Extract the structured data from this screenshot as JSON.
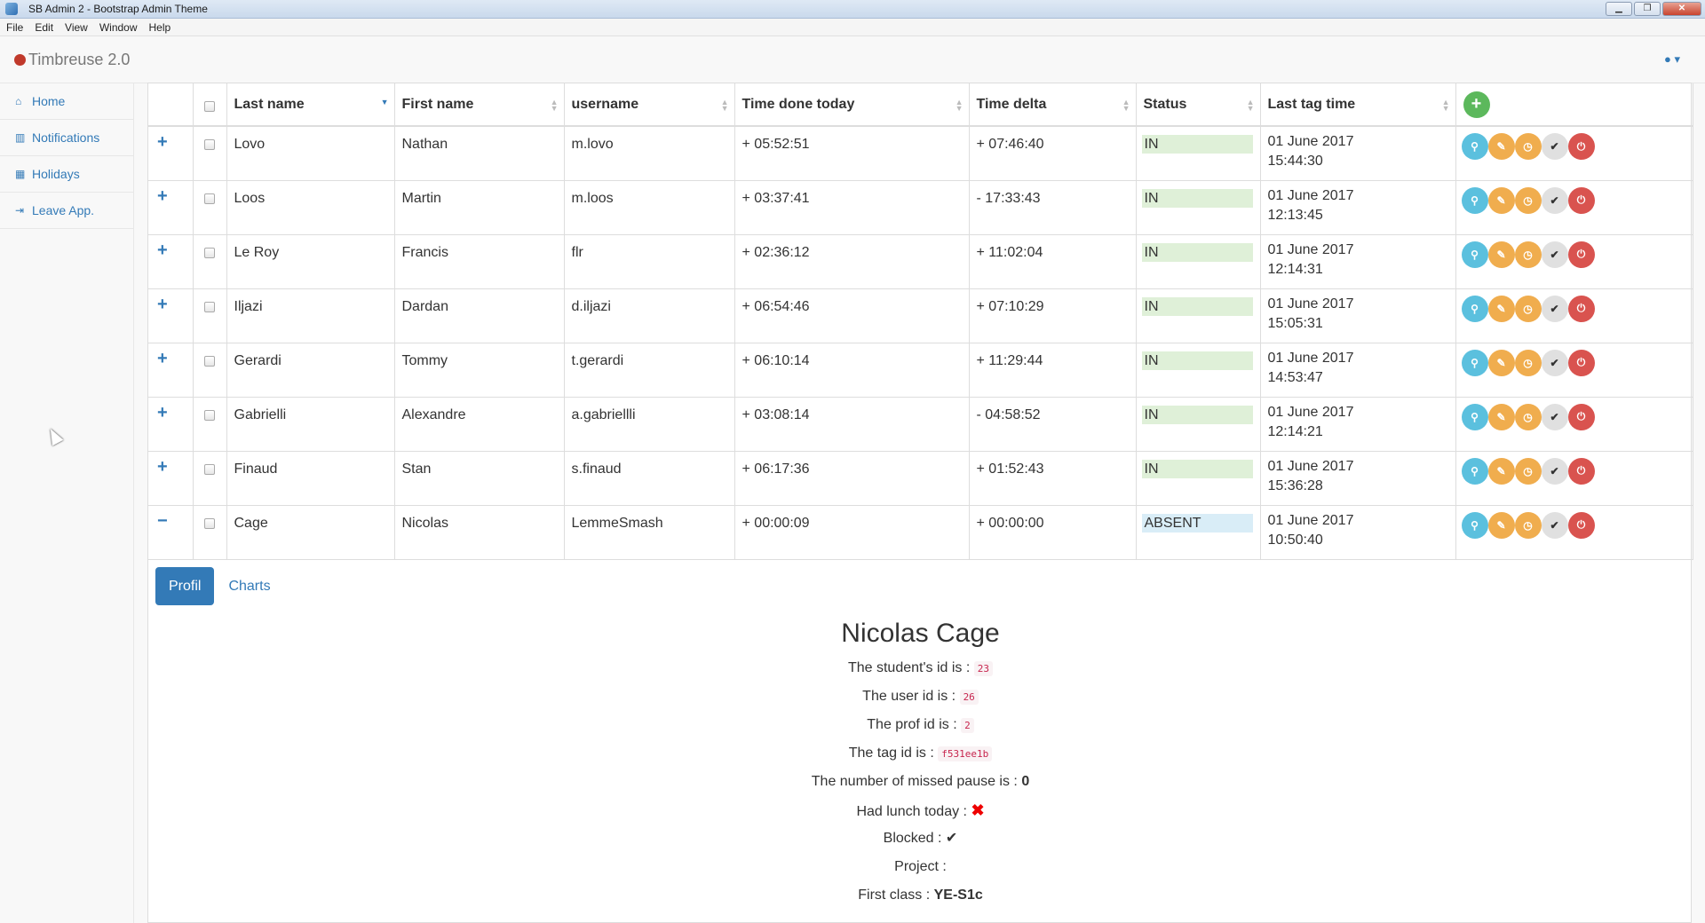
{
  "window": {
    "title": "SB Admin 2 - Bootstrap Admin Theme",
    "controls": {
      "minimize": "▁",
      "restore": "❐",
      "close": "✕"
    },
    "menu": [
      "File",
      "Edit",
      "View",
      "Window",
      "Help"
    ]
  },
  "navbar": {
    "brand": "Timbreuse 2.0",
    "user_icon": "user-icon",
    "user_caret": "▾"
  },
  "sidebar": {
    "items": [
      {
        "icon": "home-icon",
        "glyph": "⌂",
        "label": "Home"
      },
      {
        "icon": "bar-chart-icon",
        "glyph": "▥",
        "label": "Notifications"
      },
      {
        "icon": "calendar-icon",
        "glyph": "▦",
        "label": "Holidays"
      },
      {
        "icon": "sign-out-icon",
        "glyph": "⇥",
        "label": "Leave App."
      }
    ]
  },
  "table": {
    "headers": {
      "last_name": "Last name",
      "first_name": "First name",
      "username": "username",
      "time_done": "Time done today",
      "time_delta": "Time delta",
      "status": "Status",
      "last_tag": "Last tag time"
    },
    "rows": [
      {
        "expander": "+",
        "last": "Lovo",
        "first": "Nathan",
        "user": "m.lovo",
        "done": "+ 05:52:51",
        "delta": "+ 07:46:40",
        "status": "IN",
        "tag_date": "01 June 2017",
        "tag_time": "15:44:30"
      },
      {
        "expander": "+",
        "last": "Loos",
        "first": "Martin",
        "user": "m.loos",
        "done": "+ 03:37:41",
        "delta": "- 17:33:43",
        "status": "IN",
        "tag_date": "01 June 2017",
        "tag_time": "12:13:45"
      },
      {
        "expander": "+",
        "last": "Le Roy",
        "first": "Francis",
        "user": "flr",
        "done": "+ 02:36:12",
        "delta": "+ 11:02:04",
        "status": "IN",
        "tag_date": "01 June 2017",
        "tag_time": "12:14:31"
      },
      {
        "expander": "+",
        "last": "Iljazi",
        "first": "Dardan",
        "user": "d.iljazi",
        "done": "+ 06:54:46",
        "delta": "+ 07:10:29",
        "status": "IN",
        "tag_date": "01 June 2017",
        "tag_time": "15:05:31"
      },
      {
        "expander": "+",
        "last": "Gerardi",
        "first": "Tommy",
        "user": "t.gerardi",
        "done": "+ 06:10:14",
        "delta": "+ 11:29:44",
        "status": "IN",
        "tag_date": "01 June 2017",
        "tag_time": "14:53:47"
      },
      {
        "expander": "+",
        "last": "Gabrielli",
        "first": "Alexandre",
        "user": "a.gabriellli",
        "done": "+ 03:08:14",
        "delta": "- 04:58:52",
        "status": "IN",
        "tag_date": "01 June 2017",
        "tag_time": "12:14:21"
      },
      {
        "expander": "+",
        "last": "Finaud",
        "first": "Stan",
        "user": "s.finaud",
        "done": "+ 06:17:36",
        "delta": "+ 01:52:43",
        "status": "IN",
        "tag_date": "01 June 2017",
        "tag_time": "15:36:28"
      },
      {
        "expander": "−",
        "last": "Cage",
        "first": "Nicolas",
        "user": "LemmeSmash",
        "done": "+ 00:00:09",
        "delta": "+ 00:00:00",
        "status": "ABSENT",
        "tag_date": "01 June 2017",
        "tag_time": "10:50:40"
      }
    ],
    "action_icons": [
      {
        "name": "zoom-icon",
        "glyph": "⚲",
        "style": "info"
      },
      {
        "name": "edit-icon",
        "glyph": "✎",
        "style": "warn"
      },
      {
        "name": "clock-icon",
        "glyph": "◷",
        "style": "warn"
      },
      {
        "name": "check-icon",
        "glyph": "✔",
        "style": "def"
      },
      {
        "name": "power-icon",
        "glyph": "⏻",
        "style": "danger"
      }
    ],
    "add_glyph": "+"
  },
  "tabs": {
    "profil": "Profil",
    "charts": "Charts"
  },
  "profile": {
    "name": "Nicolas Cage",
    "student_id_label": "The student's id is :",
    "student_id": "23",
    "user_id_label": "The user id is :",
    "user_id": "26",
    "prof_id_label": "The prof id is :",
    "prof_id": "2",
    "tag_id_label": "The tag id is :",
    "tag_id": "f531ee1b",
    "missed_pause_label": "The number of missed pause is :",
    "missed_pause": "0",
    "lunch_label": "Had lunch today :",
    "lunch_glyph": "✖",
    "blocked_label": "Blocked :",
    "blocked_glyph": "✔",
    "project_label": "Project :",
    "first_class_label": "First class :",
    "first_class": "YE-S1c"
  },
  "colors": {
    "primary": "#337ab7",
    "in_bg": "#dff0d8",
    "absent_bg": "#d9edf7",
    "add": "#5cb85c"
  }
}
